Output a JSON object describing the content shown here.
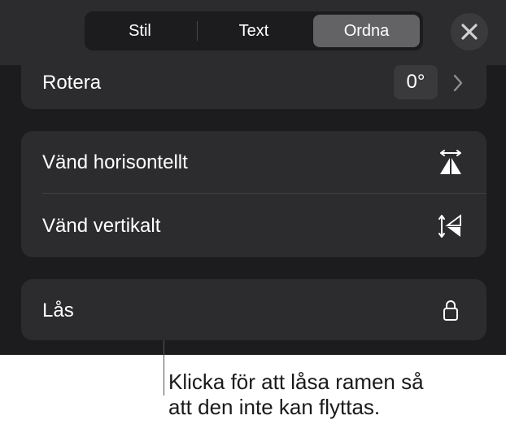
{
  "tabs": [
    {
      "label": "Stil",
      "active": false
    },
    {
      "label": "Text",
      "active": false
    },
    {
      "label": "Ordna",
      "active": true
    }
  ],
  "close": {
    "icon": "close-icon"
  },
  "rotate": {
    "label": "Rotera",
    "value": "0°",
    "icon": "chevron-right-icon"
  },
  "flip": {
    "horizontal": {
      "label": "Vänd horisontellt",
      "icon": "flip-horizontal-icon"
    },
    "vertical": {
      "label": "Vänd vertikalt",
      "icon": "flip-vertical-icon"
    }
  },
  "lock": {
    "label": "Lås",
    "icon": "lock-icon"
  },
  "callout": {
    "line1": "Klicka för att låsa ramen så",
    "line2": "att den inte kan flyttas."
  },
  "colors": {
    "panel_bg": "#1c1c1e",
    "card_bg": "#2c2c2e",
    "active_tab": "#636366",
    "text": "#ffffff"
  }
}
